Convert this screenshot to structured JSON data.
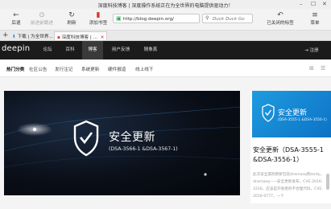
{
  "window": {
    "title": "深度科技博客 | 深度操作系统正在为全世界的电脑提供驱动力！",
    "minimize_glyph": "–",
    "maximize_glyph": "☐",
    "close_glyph": "✕"
  },
  "toolbar": {
    "back": {
      "label": "后退",
      "icon": "back-arrow-icon",
      "glyph": "←"
    },
    "forward": {
      "label": "前进前跳进",
      "icon": "forward-icon",
      "glyph": "⊙"
    },
    "refresh": {
      "label": "刷新",
      "icon": "refresh-icon",
      "glyph": "↻"
    },
    "bookmark": {
      "label": "添加书签",
      "icon": "bookmark-icon",
      "glyph": "▮"
    },
    "url": "http://blog.deepin.org/",
    "search_placeholder": "Duck Duck Go",
    "closed_tabs": {
      "label": "已关闭的标签",
      "icon": "closed-tabs-icon",
      "glyph": "↶"
    },
    "menu": {
      "label": "菜单",
      "icon": "hamburger-menu-icon",
      "glyph": "≡"
    }
  },
  "tabs": {
    "newtab_glyph": "+",
    "items": [
      {
        "label": "下载 | 为全世界..."
      },
      {
        "label": "深度科技博客 | ..."
      }
    ]
  },
  "site": {
    "logo": "deepin",
    "nav": [
      "论坛",
      "百科",
      "博客",
      "用户反馈",
      "随象蒸"
    ],
    "active_nav": 2,
    "login": "⇥  注册",
    "subnav": [
      "热门分类",
      "社区公告",
      "发行注记",
      "系统更新",
      "硬件报道",
      "线上线下"
    ],
    "view_icons": [
      "⊞",
      "☰"
    ]
  },
  "hero": {
    "title": "安全更新",
    "subtitle": "(DSA-3566-1 &DSA-3567-1)"
  },
  "side_card": {
    "thumb_title": "安全更新",
    "thumb_sub": "(DSA-3555-1 &DSA-3556-1)",
    "title": "安全更新（DSA-3555-1 &DSA-3556-1）",
    "description": "此次安全漏洞更新包括dnsmasq和tardy，dnsmasq——安全更新发布，CVE-2016-3316，应该是开发者的不合理代码，CVE-2016-0777，一个"
  }
}
